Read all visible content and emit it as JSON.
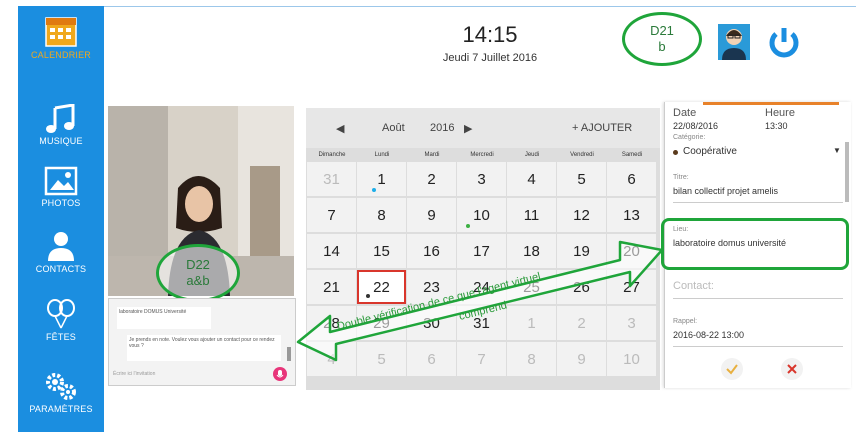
{
  "sidebar": {
    "items": [
      {
        "label": "CALENDRIER"
      },
      {
        "label": "MUSIQUE"
      },
      {
        "label": "PHOTOS"
      },
      {
        "label": "CONTACTS"
      },
      {
        "label": "FÊTES"
      },
      {
        "label": "PARAMÈTRES"
      }
    ]
  },
  "header": {
    "time": "14:15",
    "date": "Jeudi 7 Juillet 2016"
  },
  "annotations": {
    "d21_line1": "D21",
    "d21_line2": "b",
    "d22_line1": "D22",
    "d22_line2": "a&b",
    "arrow_line1": "Double vérification de ce que l'agent virtuel",
    "arrow_line2": "comprend"
  },
  "calendar": {
    "prev_icon": "left-arrow",
    "next_icon": "right-arrow",
    "month": "Août",
    "year": "2016",
    "add_label": "+ AJOUTER",
    "weekdays": [
      "Dimanche",
      "Lundi",
      "Mardi",
      "Mercredi",
      "Jeudi",
      "Vendredi",
      "Samedi"
    ],
    "weeks": [
      [
        "31",
        "1",
        "2",
        "3",
        "4",
        "5",
        "6"
      ],
      [
        "7",
        "8",
        "9",
        "10",
        "11",
        "12",
        "13"
      ],
      [
        "14",
        "15",
        "16",
        "17",
        "18",
        "19",
        "20"
      ],
      [
        "21",
        "22",
        "23",
        "24",
        "25",
        "26",
        "27"
      ],
      [
        "28",
        "29",
        "30",
        "31",
        "1",
        "2",
        "3"
      ],
      [
        "4",
        "5",
        "6",
        "7",
        "8",
        "9",
        "10"
      ]
    ],
    "today": "22"
  },
  "panel": {
    "date_label": "Date",
    "time_label": "Heure",
    "date_value": "22/08/2016",
    "time_value": "13:30",
    "category_label": "Catégorie:",
    "category_value": "Coopérative",
    "title_label": "Titre:",
    "title_value": "bilan collectif projet amelis",
    "place_label": "Lieu:",
    "place_value": "laboratoire domus université",
    "contact_placeholder": "Contact:",
    "reminder_label": "Rappel:",
    "reminder_value": "2016-08-22 13:00",
    "confirm_icon": "check-icon",
    "cancel_icon": "close-icon",
    "accent": "#e8822a"
  },
  "chat": {
    "msg1": "laboratoire DOMUS Université",
    "msg2": "Je prends en note. Voulez vous ajouter un contact pour ce rendez vous ?",
    "input_placeholder": "Écrire ici l'invitation"
  }
}
